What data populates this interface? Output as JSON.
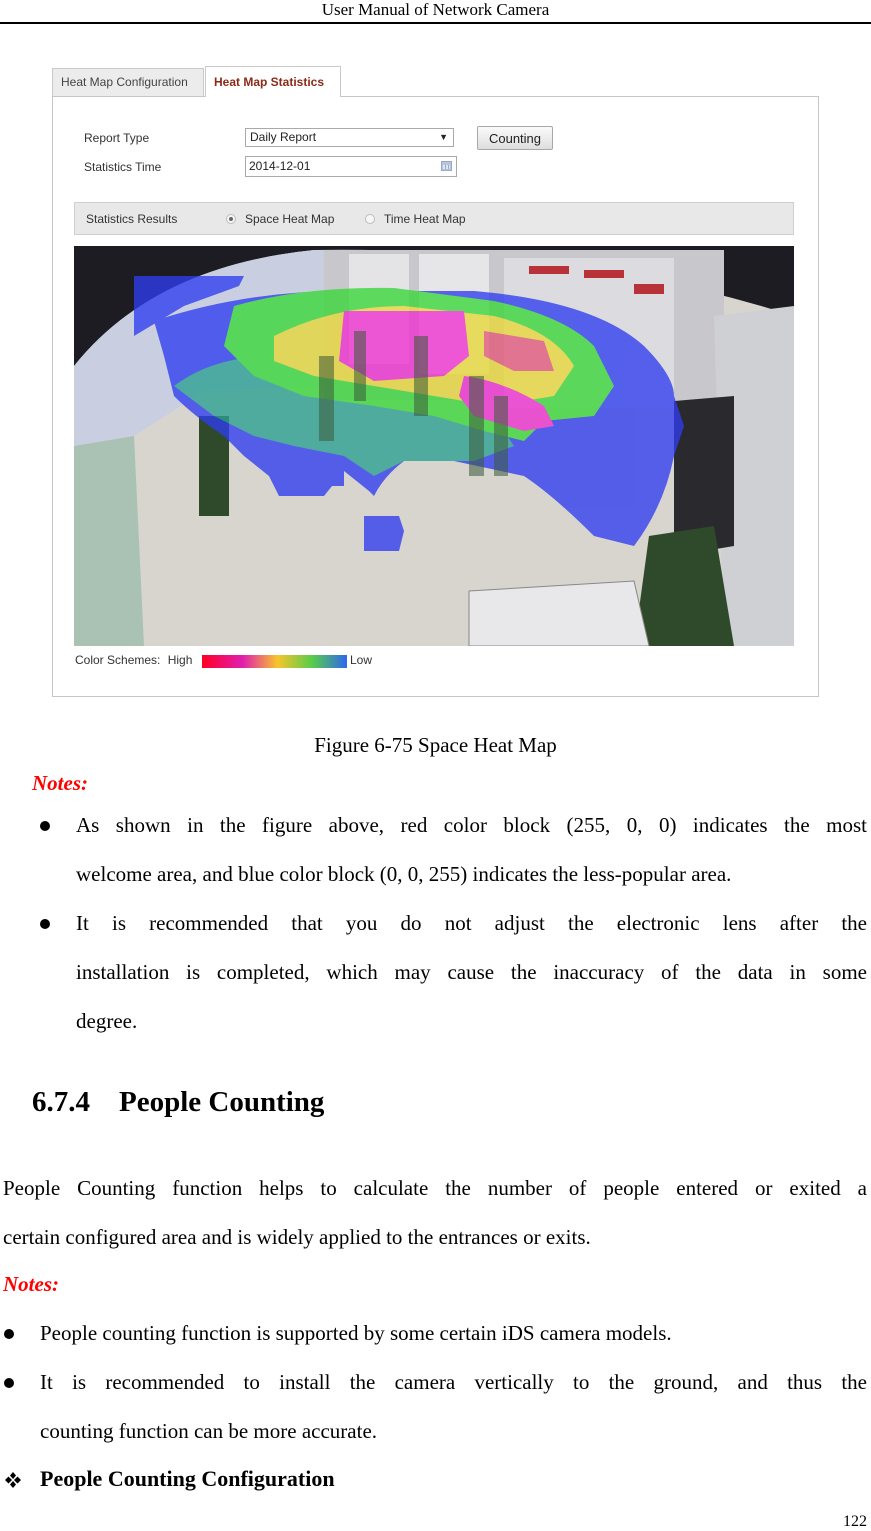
{
  "header": {
    "title": "User Manual of Network Camera"
  },
  "figure": {
    "tabs": [
      {
        "label": "Heat Map Configuration",
        "active": false
      },
      {
        "label": "Heat Map Statistics",
        "active": true
      }
    ],
    "form": {
      "report_type_label": "Report Type",
      "report_type_value": "Daily Report",
      "statistics_time_label": "Statistics Time",
      "statistics_time_value": "2014-12-01",
      "counting_button": "Counting"
    },
    "results": {
      "label": "Statistics Results",
      "options": [
        {
          "label": "Space Heat Map",
          "selected": true
        },
        {
          "label": "Time Heat Map",
          "selected": false
        }
      ]
    },
    "color_scheme": {
      "label": "Color Schemes:",
      "high_label": "High",
      "low_label": "Low",
      "gradient_colors": [
        "#ff0022",
        "#e01fb0",
        "#f7c52c",
        "#58cc4a",
        "#2f66f0"
      ]
    },
    "heatmap_image": {
      "description": "Space heat map overlay on a camera view of a showroom",
      "high_color": "#ff00cc",
      "low_color": "#2f3cf0"
    }
  },
  "caption": "Figure 6-75 Space Heat Map",
  "notes1": {
    "label": "Notes:",
    "items": [
      {
        "line1": "As shown in the figure above, red color block (255, 0, 0) indicates the most",
        "line2": "welcome area, and blue color block (0, 0, 255) indicates the less-popular area."
      },
      {
        "line1": "It is recommended that you do not adjust the electronic lens after the",
        "line2": "installation is completed, which may cause the inaccuracy of the data in some",
        "line3": "degree."
      }
    ]
  },
  "section": {
    "number": "6.7.4",
    "title": "People Counting"
  },
  "intro": {
    "line1": "People Counting function helps to calculate the number of people entered or exited a",
    "line2": "certain configured area and is widely applied to the entrances or exits."
  },
  "notes2": {
    "label": "Notes:",
    "items": [
      {
        "line1": "People counting function is supported by some certain iDS camera models."
      },
      {
        "line1": "It is recommended to install the camera vertically to the ground, and thus the",
        "line2": "counting function can be more accurate."
      }
    ]
  },
  "subsection": {
    "title": "People Counting Configuration"
  },
  "page_number": "122"
}
